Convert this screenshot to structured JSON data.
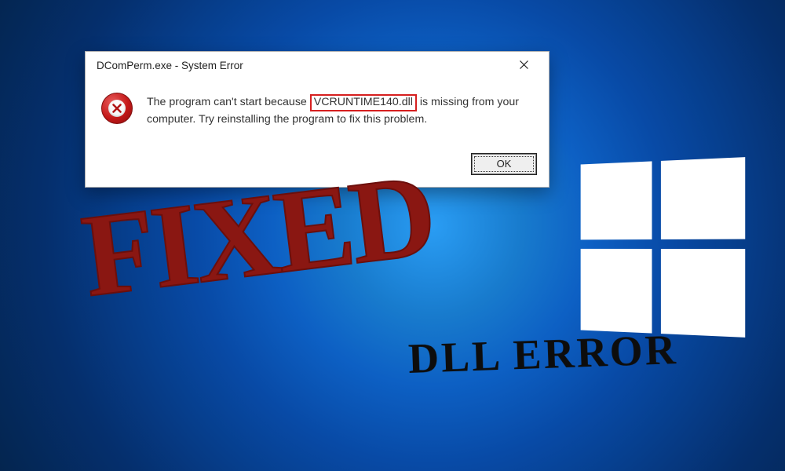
{
  "dialog": {
    "title": "DComPerm.exe - System Error",
    "message_before": "The program can't start because ",
    "highlighted_dll": "VCRUNTIME140.dll",
    "message_after": " is missing from your computer. Try reinstalling the program to fix this problem.",
    "ok_label": "OK"
  },
  "overlay": {
    "fixed_stamp": "FIXED",
    "dll_error_label": "DLL ERROR"
  }
}
